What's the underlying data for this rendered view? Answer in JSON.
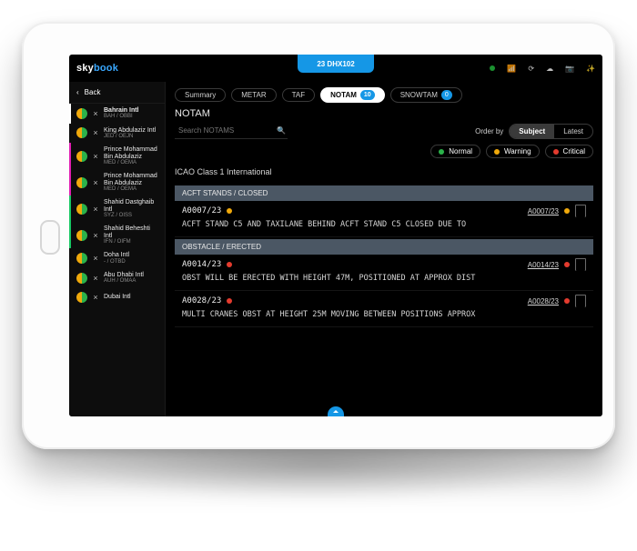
{
  "brand": {
    "pre": "sky",
    "suf": "book"
  },
  "dock": "23 DHX102",
  "back": "Back",
  "tabs": {
    "summary": "Summary",
    "metar": "METAR",
    "taf": "TAF",
    "notam": "NOTAM",
    "notam_badge": "10",
    "snowtam": "SNOWTAM",
    "snowtam_badge": "0"
  },
  "title": "NOTAM",
  "search_placeholder": "Search NOTAMS",
  "order": {
    "label": "Order by",
    "subject": "Subject",
    "latest": "Latest"
  },
  "legend": {
    "normal": "Normal",
    "warning": "Warning",
    "critical": "Critical"
  },
  "class_line": "ICAO Class 1 International",
  "airports": [
    {
      "name": "Bahrain Intl",
      "code": "BAH / OBBI",
      "sel": true,
      "accent": ""
    },
    {
      "name": "King Abdulaziz Intl",
      "code": "JED / OEJN",
      "accent": ""
    },
    {
      "name": "Prince Mohammad Bin Abdulaziz",
      "code": "MED / OEMA",
      "accent": "mag"
    },
    {
      "name": "Prince Mohammad Bin Abdulaziz",
      "code": "MED / OEMA",
      "accent": "mag"
    },
    {
      "name": "Shahid Dastghaib Intl",
      "code": "SYZ / OISS",
      "accent": "grn"
    },
    {
      "name": "Shahid Beheshti Intl",
      "code": "IFN / OIFM",
      "accent": "grn"
    },
    {
      "name": "Doha Intl",
      "code": "- / OTBD",
      "accent": ""
    },
    {
      "name": "Abu Dhabi Intl",
      "code": "AUH / OMAA",
      "accent": ""
    },
    {
      "name": "Dubai Intl",
      "code": "",
      "accent": ""
    }
  ],
  "groups": [
    {
      "header": "ACFT STANDS / CLOSED",
      "items": [
        {
          "id": "A0007/23",
          "sev": "y",
          "text": "ACFT STAND C5 AND TAXILANE BEHIND ACFT STAND C5 CLOSED DUE TO",
          "ref": "A0007/23"
        }
      ]
    },
    {
      "header": "OBSTACLE / ERECTED",
      "items": [
        {
          "id": "A0014/23",
          "sev": "r",
          "text": "OBST WILL BE ERECTED WITH HEIGHT 47M, POSITIONED AT APPROX DIST",
          "ref": "A0014/23"
        },
        {
          "id": "A0028/23",
          "sev": "r",
          "text": "MULTI CRANES OBST AT HEIGHT 25M MOVING BETWEEN POSITIONS APPROX",
          "ref": "A0028/23"
        }
      ]
    }
  ]
}
